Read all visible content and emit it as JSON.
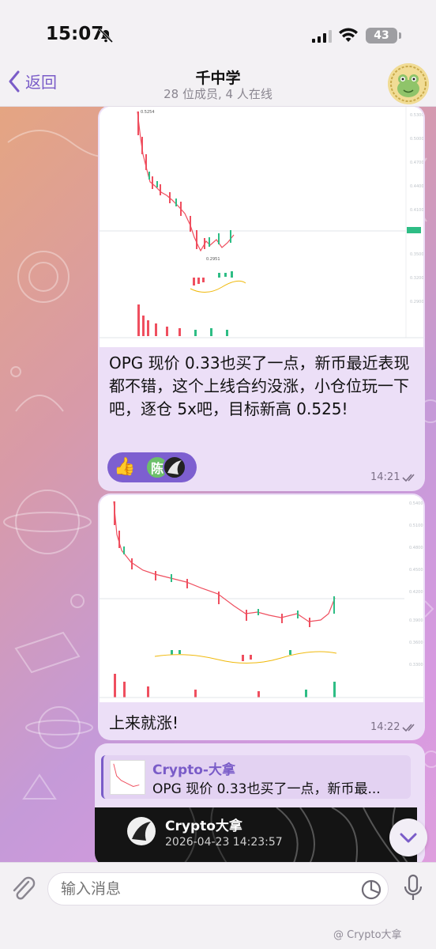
{
  "status_bar": {
    "time": "15:07",
    "battery": "43"
  },
  "header": {
    "back_label": "返回",
    "title": "千中学",
    "subtitle": "28 位成员, 4 人在线"
  },
  "messages": [
    {
      "text": "OPG 现价 0.33也买了一点，新币最近表现都不错，这个上线合约没涨，小仓位玩一下吧，逐仓 5x吧，目标新高 0.525!",
      "time": "14:21",
      "reactions": [
        "thumbs-up",
        "陈",
        "avatar"
      ],
      "chart_high_label": "0.5254",
      "chart_low_label": "0.2951"
    },
    {
      "text": "上来就涨!",
      "time": "14:22"
    },
    {
      "quote_name": "Crypto-大拿",
      "quote_text": "OPG 现价 0.33也买了一点，新币最...",
      "video_name": "Crypto大拿",
      "video_date": "2026-04-23 14:23:57"
    }
  ],
  "input": {
    "placeholder": "输入消息"
  },
  "watermark": "@ Crypto大拿",
  "icons": [
    "bell-off-icon",
    "signal-icon",
    "wifi-icon",
    "battery-icon",
    "back-chevron-icon",
    "double-check-icon",
    "attach-icon",
    "sticker-icon",
    "mic-icon",
    "chevron-down-icon"
  ]
}
